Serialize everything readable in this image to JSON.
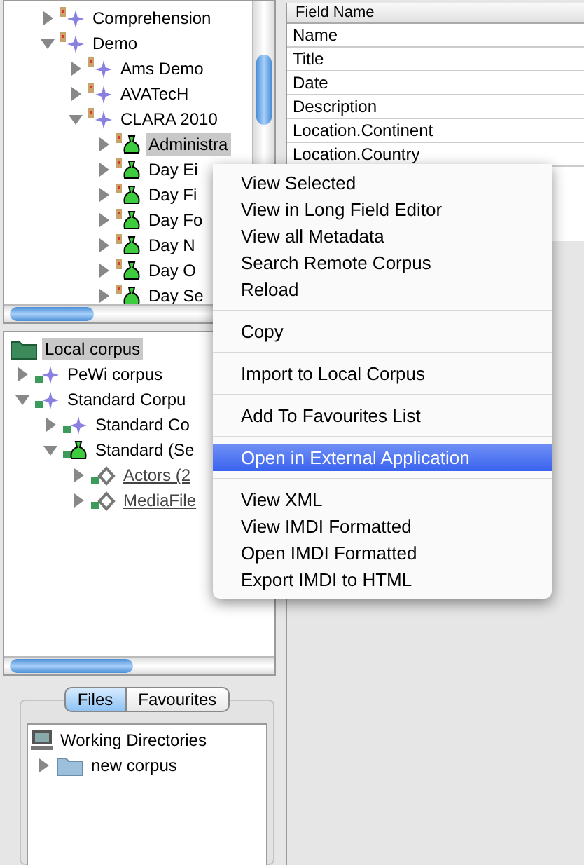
{
  "remote_tree": {
    "nodes": [
      {
        "label": "Comprehension",
        "kind": "corpus",
        "expanded": false,
        "selected": false
      },
      {
        "label": "Demo",
        "kind": "corpus",
        "expanded": true,
        "selected": false,
        "children": [
          {
            "label": "Ams Demo",
            "kind": "corpus",
            "expanded": false,
            "selected": false
          },
          {
            "label": "AVATecH",
            "kind": "corpus",
            "expanded": false,
            "selected": false
          },
          {
            "label": "CLARA 2010",
            "kind": "corpus",
            "expanded": true,
            "selected": false,
            "children": [
              {
                "label": "Administra",
                "kind": "session",
                "expanded": false,
                "selected": true
              },
              {
                "label": "Day Ei",
                "kind": "session",
                "expanded": false,
                "selected": false
              },
              {
                "label": "Day Fi",
                "kind": "session",
                "expanded": false,
                "selected": false
              },
              {
                "label": "Day Fo",
                "kind": "session",
                "expanded": false,
                "selected": false
              },
              {
                "label": "Day N",
                "kind": "session",
                "expanded": false,
                "selected": false
              },
              {
                "label": "Day O",
                "kind": "session",
                "expanded": false,
                "selected": false
              },
              {
                "label": "Day Se",
                "kind": "session",
                "expanded": false,
                "selected": false
              }
            ]
          }
        ]
      }
    ]
  },
  "local_tree": {
    "root": {
      "label": "Local corpus",
      "selected": true
    },
    "nodes": [
      {
        "label": "PeWi corpus",
        "kind": "corpus",
        "expanded": false,
        "selected": false
      },
      {
        "label": "Standard Corpu",
        "kind": "corpus",
        "expanded": true,
        "selected": false,
        "children": [
          {
            "label": "Standard Co",
            "kind": "corpus",
            "expanded": false,
            "selected": false
          },
          {
            "label": "Standard (Se",
            "kind": "session",
            "expanded": true,
            "selected": false,
            "children": [
              {
                "label": "Actors (2",
                "kind": "info",
                "expanded": false,
                "selected": false
              },
              {
                "label": "MediaFile",
                "kind": "info",
                "expanded": false,
                "selected": false
              }
            ]
          }
        ]
      }
    ]
  },
  "tabs": [
    {
      "label": "Files",
      "selected": true
    },
    {
      "label": "Favourites",
      "selected": false
    }
  ],
  "files_tree": [
    {
      "label": "Working Directories",
      "kind": "computer"
    },
    {
      "label": "new corpus",
      "kind": "folder"
    }
  ],
  "table": {
    "column": "Field Name",
    "rows": [
      "Name",
      "Title",
      "Date",
      "Description",
      "Location.Continent",
      "Location.Country"
    ]
  },
  "context_menu": {
    "groups": [
      [
        {
          "label": "View Selected",
          "selected": false
        },
        {
          "label": "View in Long Field Editor",
          "selected": false
        },
        {
          "label": "View all Metadata",
          "selected": false
        },
        {
          "label": "Search Remote Corpus",
          "selected": false
        },
        {
          "label": "Reload",
          "selected": false
        }
      ],
      [
        {
          "label": "Copy",
          "selected": false
        }
      ],
      [
        {
          "label": "Import to Local Corpus",
          "selected": false
        }
      ],
      [
        {
          "label": "Add To Favourites List",
          "selected": false
        }
      ],
      [
        {
          "label": "Open in External Application",
          "selected": true
        }
      ],
      [
        {
          "label": "View XML",
          "selected": false
        },
        {
          "label": "View IMDI Formatted",
          "selected": false
        },
        {
          "label": "Open IMDI Formatted",
          "selected": false
        },
        {
          "label": "Export IMDI to HTML",
          "selected": false
        }
      ]
    ]
  }
}
